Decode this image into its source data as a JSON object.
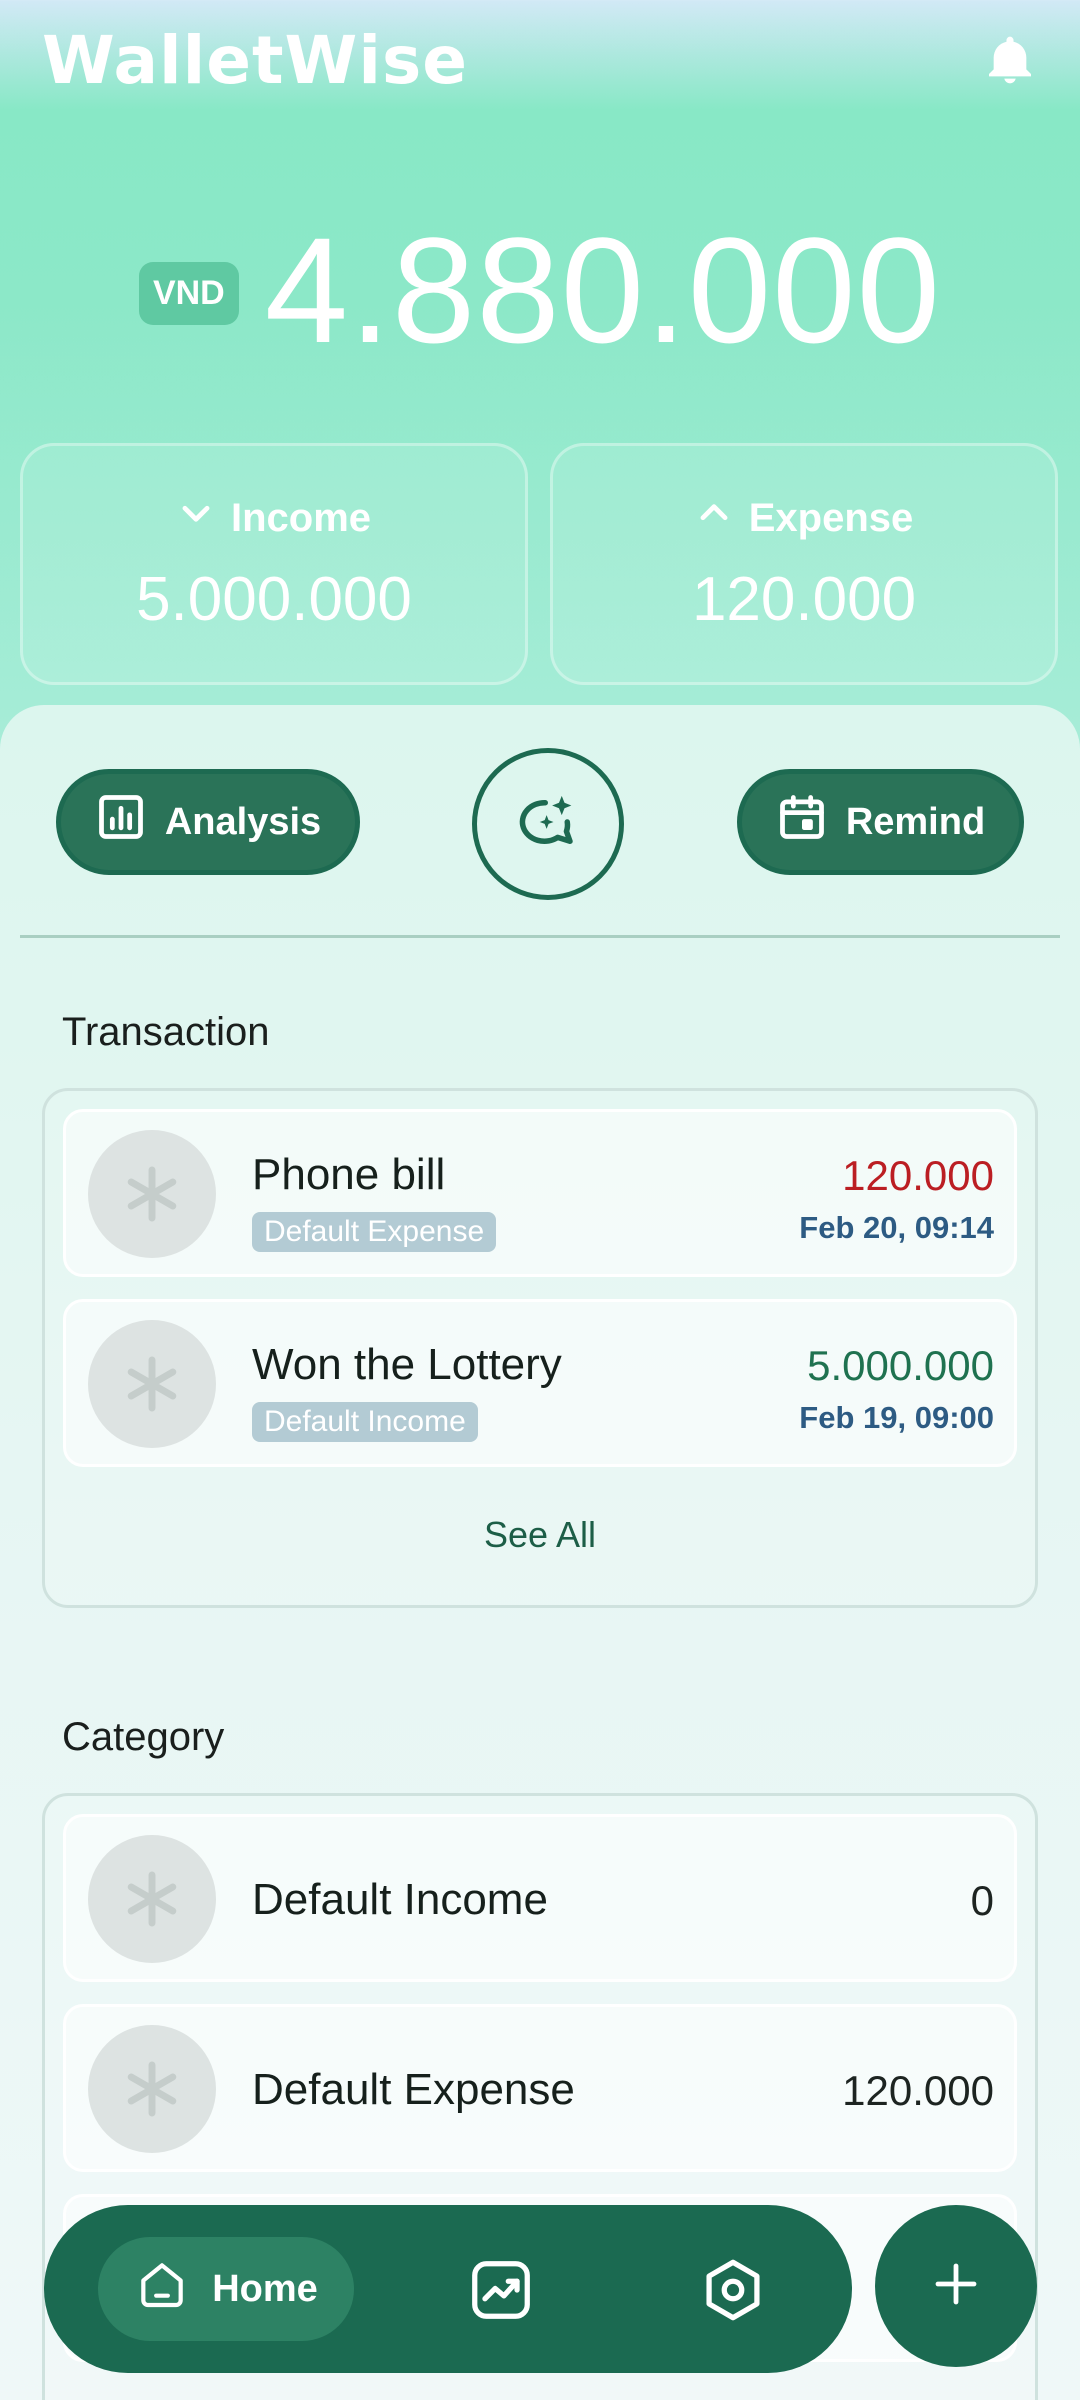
{
  "app": {
    "title": "WalletWise"
  },
  "balance": {
    "currency": "VND",
    "amount": "4.880.000"
  },
  "summary": {
    "income": {
      "label": "Income",
      "value": "5.000.000"
    },
    "expense": {
      "label": "Expense",
      "value": "120.000"
    }
  },
  "actions": {
    "analysis_label": "Analysis",
    "remind_label": "Remind"
  },
  "transactions": {
    "title": "Transaction",
    "items": [
      {
        "name": "Phone bill",
        "category": "Default Expense",
        "amount": "120.000",
        "date": "Feb 20, 09:14",
        "type": "expense"
      },
      {
        "name": "Won the Lottery",
        "category": "Default Income",
        "amount": "5.000.000",
        "date": "Feb 19, 09:00",
        "type": "income"
      }
    ],
    "see_all": "See All"
  },
  "categories": {
    "title": "Category",
    "items": [
      {
        "name": "Default Income",
        "amount": "0"
      },
      {
        "name": "Default Expense",
        "amount": "120.000"
      }
    ]
  },
  "nav": {
    "home_label": "Home"
  },
  "colors": {
    "primary": "#1b6a51",
    "expense_amount": "#bb1e23",
    "income_amount": "#1f7250",
    "date": "#2d5b83"
  }
}
